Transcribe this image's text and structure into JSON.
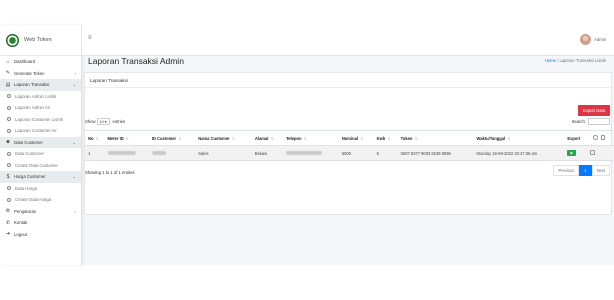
{
  "brand": {
    "title": "Web Token"
  },
  "topbar": {
    "user_name": "Admin"
  },
  "sidebar": {
    "items": [
      {
        "label": "Dashboard",
        "icon": "home-icon",
        "glyph": "⌂"
      },
      {
        "label": "Generate Token",
        "icon": "edit-icon",
        "glyph": "✎",
        "chevron": "›"
      },
      {
        "label": "Laporan Transaksi",
        "icon": "book-icon",
        "glyph": "▤",
        "chevron": "⌄",
        "active": true
      },
      {
        "label": "Laporan Admin Listrik",
        "sub": true
      },
      {
        "label": "Laporan Admin Air",
        "sub": true
      },
      {
        "label": "Laporan Customer Listrik",
        "sub": true
      },
      {
        "label": "Laporan Customer Air",
        "sub": true
      },
      {
        "label": "Data Customer",
        "icon": "users-icon",
        "glyph": "☻",
        "chevron": "⌄",
        "active": true
      },
      {
        "label": "Data Customer",
        "sub": true
      },
      {
        "label": "Create Data Customer",
        "sub": true
      },
      {
        "label": "Harga Customer",
        "icon": "dollar-icon",
        "glyph": "$",
        "chevron": "⌄",
        "active": true
      },
      {
        "label": "Data Harga",
        "sub": true
      },
      {
        "label": "Create Data Harga",
        "sub": true
      },
      {
        "label": "Pengaturan",
        "icon": "gears-icon",
        "glyph": "⚙",
        "chevron": "›"
      },
      {
        "label": "Kontak",
        "icon": "phone-icon",
        "glyph": "✆"
      },
      {
        "label": "Logout",
        "icon": "logout-icon",
        "glyph": "➜"
      }
    ]
  },
  "content": {
    "heading": "Laporan Transaksi Admin",
    "breadcrumb": {
      "home": "Home",
      "separator": "/",
      "current": "Laporan Transaksi Listrik"
    },
    "card_title": "Laporan Transaksi",
    "export_label": "Export Data",
    "show_label": "Show",
    "show_value": "10",
    "entries_label": "entries",
    "search_label": "Search:",
    "columns": [
      "No",
      "Meter ID",
      "ID Customer",
      "Nama Customer",
      "Alamat",
      "Telepon",
      "Nominal",
      "Kwh",
      "Token",
      "Waktu/Tanggal",
      "Export"
    ],
    "row": {
      "no": "1",
      "nama": "Sales",
      "alamat": "Bekasi",
      "nominal": "5000",
      "kwh": "5",
      "token": "0607 8377 9003 8238 8596",
      "waktu": "Monday 19-09-2022 20:47:36 am"
    },
    "info": "Showing 1 to 1 of 1 entries",
    "pagination": {
      "previous": "Previous",
      "page": "1",
      "next": "Next"
    }
  }
}
